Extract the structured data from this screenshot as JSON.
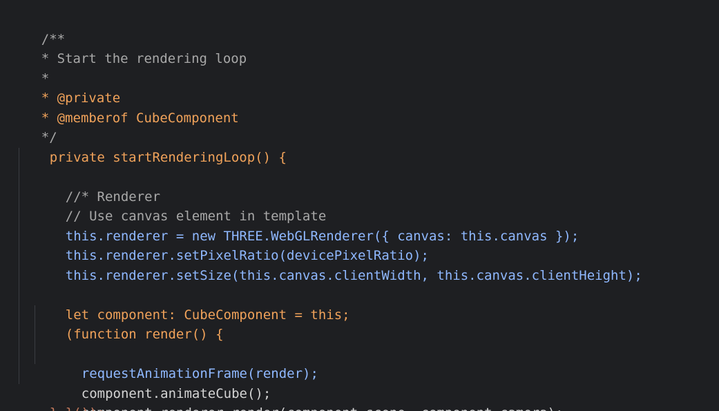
{
  "editor": {
    "lines": [
      "/**",
      "* Start the rendering loop",
      "*",
      "* @private",
      "* @memberof CubeComponent",
      "*/",
      "private startRenderingLoop() {",
      "//* Renderer",
      "// Use canvas element in template",
      "this.renderer = new THREE.WebGLRenderer({ canvas: this.canvas });",
      "this.renderer.setPixelRatio(devicePixelRatio);",
      "this.renderer.setSize(this.canvas.clientWidth, this.canvas.clientHeight);",
      "",
      "let component: CubeComponent = this;",
      "(function render() {",
      "requestAnimationFrame(render);",
      "component.animateCube();",
      "component.renderer.render(component.scene, component.camera);",
      "}());",
      "}"
    ]
  }
}
